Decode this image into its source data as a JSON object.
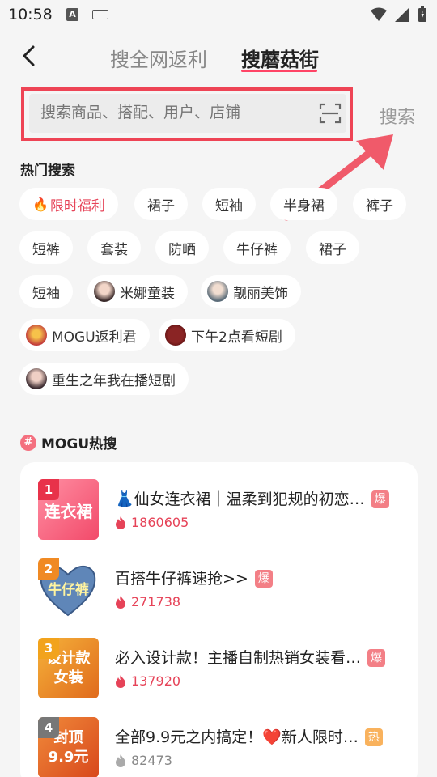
{
  "status": {
    "time": "10:58"
  },
  "header": {
    "tab_rebate": "搜全网返利",
    "tab_mogu": "搜蘑菇街"
  },
  "search": {
    "placeholder": "搜索商品、搭配、用户、店铺",
    "button": "搜索"
  },
  "hot_search": {
    "title": "热门搜索",
    "chips": [
      {
        "label": "限时福利",
        "icon": "fire-icon"
      },
      {
        "label": "裙子"
      },
      {
        "label": "短袖"
      },
      {
        "label": "半身裙"
      },
      {
        "label": "裤子"
      },
      {
        "label": "短裤"
      },
      {
        "label": "套装"
      },
      {
        "label": "防晒"
      },
      {
        "label": "牛仔裤"
      },
      {
        "label": "裙子"
      },
      {
        "label": "短袖"
      },
      {
        "label": "米娜童装",
        "icon": "avatar"
      },
      {
        "label": "靓丽美饰",
        "icon": "avatar"
      },
      {
        "label": "MOGU返利君",
        "icon": "avatar"
      },
      {
        "label": "下午2点看短剧",
        "icon": "avatar"
      },
      {
        "label": "重生之年我在播短剧",
        "icon": "avatar"
      }
    ]
  },
  "mogu_hot": {
    "badge": "#",
    "title": "MOGU热搜",
    "items": [
      {
        "rank": "1",
        "thumb_text": "连衣裙",
        "title": "👗仙女连衣裙｜温柔到犯规的初恋…",
        "tag": "爆",
        "count": "1860605"
      },
      {
        "rank": "2",
        "thumb_text": "牛仔裤",
        "title": "百搭牛仔裤速抢>>",
        "tag": "爆",
        "count": "271738"
      },
      {
        "rank": "3",
        "thumb_text": "设计款\n女装",
        "title": "必入设计款！主播自制热销女装看…",
        "tag": "爆",
        "count": "137920"
      },
      {
        "rank": "4",
        "thumb_text": "封顶\n9.9元",
        "title": "全部9.9元之内搞定！❤️新人限时…",
        "tag": "热",
        "count": "82473"
      }
    ]
  },
  "colors": {
    "accent": "#ff4466",
    "highlight_border": "#ee4455",
    "arrow": "#f05a6a"
  }
}
